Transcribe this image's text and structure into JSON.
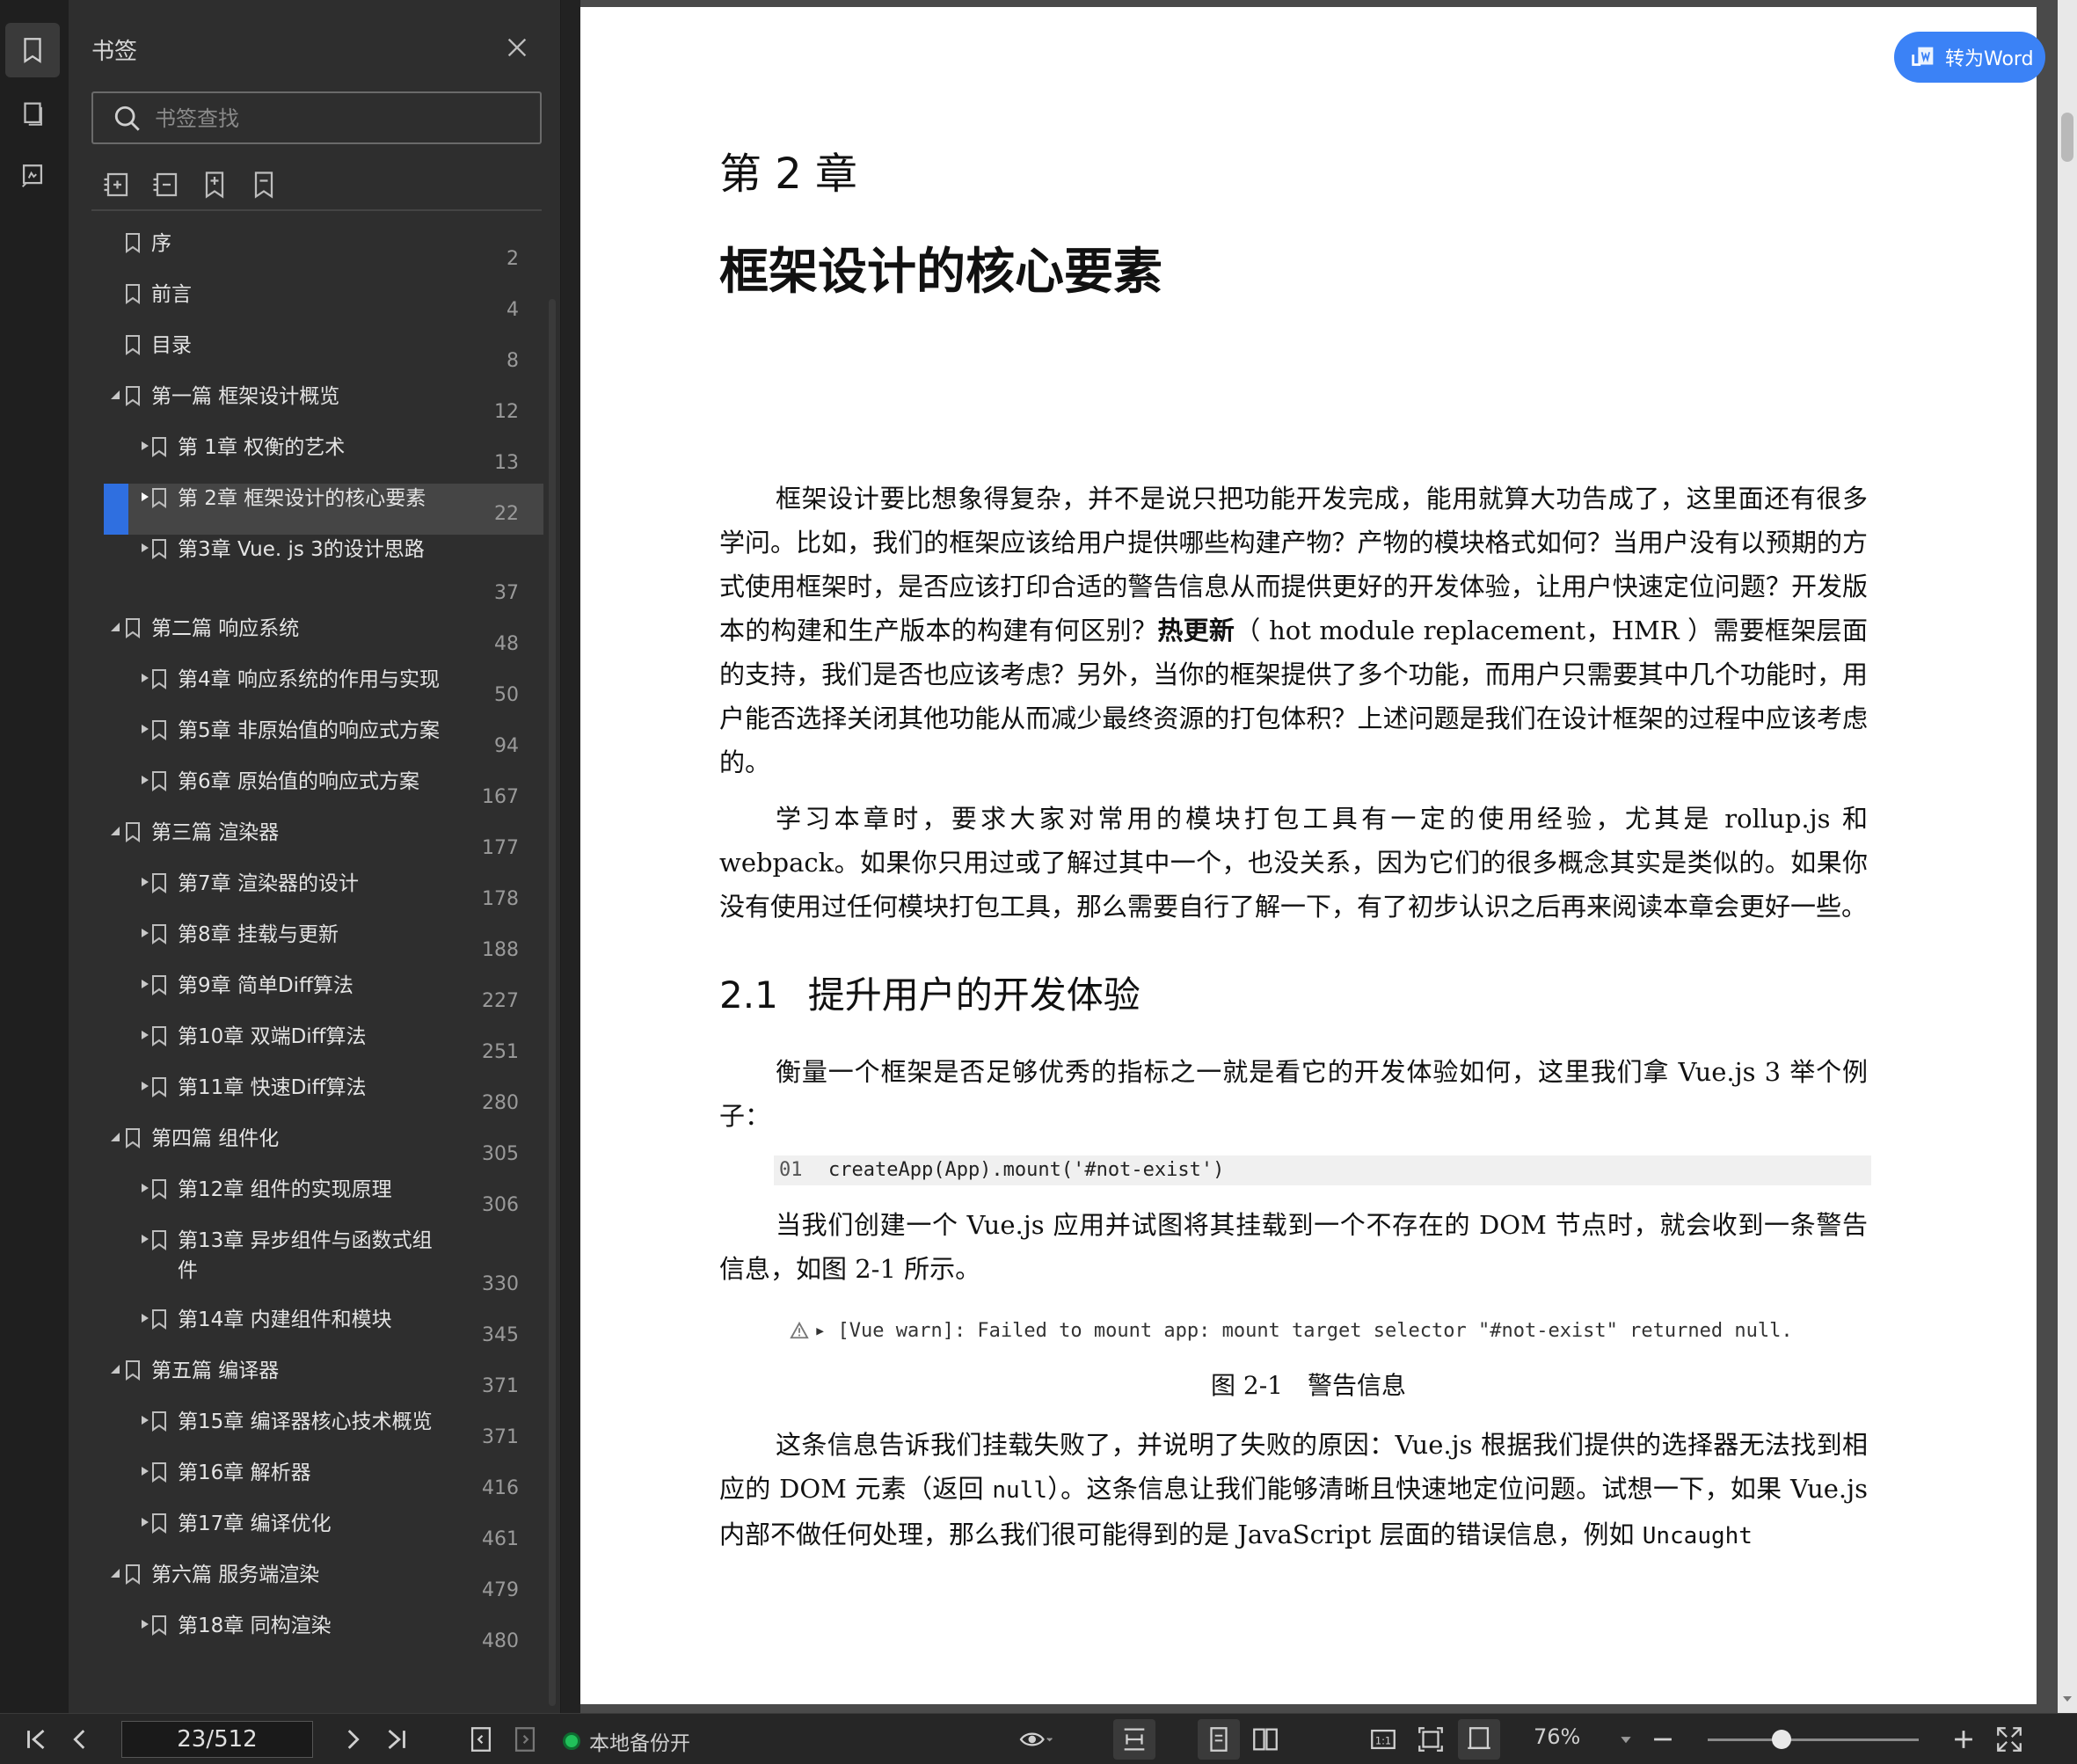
{
  "sidebar_panel": {
    "title": "书签",
    "search_placeholder": "书签查找",
    "items": [
      {
        "label": "序",
        "page": "2",
        "level": 0,
        "has_arrow": false
      },
      {
        "label": "前言",
        "page": "4",
        "level": 0,
        "has_arrow": false
      },
      {
        "label": "目录",
        "page": "8",
        "level": 0,
        "has_arrow": false
      },
      {
        "label": "第一篇 框架设计概览",
        "page": "12",
        "level": 0,
        "has_arrow": true,
        "expanded": true
      },
      {
        "label": "第 1章 权衡的艺术",
        "page": "13",
        "level": 1,
        "has_arrow": true
      },
      {
        "label": "第 2章 框架设计的核心要素",
        "page": "22",
        "level": 1,
        "has_arrow": true,
        "selected": true
      },
      {
        "label": "第3章 Vue. js 3的设计思路",
        "page": "37",
        "level": 1,
        "has_arrow": true
      },
      {
        "label": "第二篇 响应系统",
        "page": "48",
        "level": 0,
        "has_arrow": true,
        "expanded": true
      },
      {
        "label": "第4章 响应系统的作用与实现",
        "page": "50",
        "level": 1,
        "has_arrow": true
      },
      {
        "label": "第5章 非原始值的响应式方案",
        "page": "94",
        "level": 1,
        "has_arrow": true
      },
      {
        "label": "第6章 原始值的响应式方案",
        "page": "167",
        "level": 1,
        "has_arrow": true
      },
      {
        "label": "第三篇 渲染器",
        "page": "177",
        "level": 0,
        "has_arrow": true,
        "expanded": true
      },
      {
        "label": "第7章 渲染器的设计",
        "page": "178",
        "level": 1,
        "has_arrow": true
      },
      {
        "label": "第8章 挂载与更新",
        "page": "188",
        "level": 1,
        "has_arrow": true
      },
      {
        "label": "第9章 简单Diff算法",
        "page": "227",
        "level": 1,
        "has_arrow": true
      },
      {
        "label": "第10章 双端Diff算法",
        "page": "251",
        "level": 1,
        "has_arrow": true
      },
      {
        "label": "第11章 快速Diff算法",
        "page": "280",
        "level": 1,
        "has_arrow": true
      },
      {
        "label": "第四篇 组件化",
        "page": "305",
        "level": 0,
        "has_arrow": true,
        "expanded": true
      },
      {
        "label": "第12章 组件的实现原理",
        "page": "306",
        "level": 1,
        "has_arrow": true
      },
      {
        "label": "第13章 异步组件与函数式组件",
        "page": "330",
        "level": 1,
        "has_arrow": true
      },
      {
        "label": "第14章 内建组件和模块",
        "page": "345",
        "level": 1,
        "has_arrow": true
      },
      {
        "label": "第五篇 编译器",
        "page": "371",
        "level": 0,
        "has_arrow": true,
        "expanded": true
      },
      {
        "label": "第15章 编译器核心技术概览",
        "page": "371",
        "level": 1,
        "has_arrow": true
      },
      {
        "label": "第16章 解析器",
        "page": "416",
        "level": 1,
        "has_arrow": true
      },
      {
        "label": "第17章 编译优化",
        "page": "461",
        "level": 1,
        "has_arrow": true
      },
      {
        "label": "第六篇 服务端渲染",
        "page": "479",
        "level": 0,
        "has_arrow": true,
        "expanded": true
      },
      {
        "label": "第18章 同构渲染",
        "page": "480",
        "level": 1,
        "has_arrow": true
      }
    ]
  },
  "document": {
    "to_word_label": "转为Word",
    "chapter_number": "第 2 章",
    "chapter_title": "框架设计的核心要素",
    "para1_a": "框架设计要比想象得复杂，并不是说只把功能开发完成，能用就算大功告成了，这里面还有很多学问。比如，我们的框架应该给用户提供哪些构建产物？产物的模块格式如何？当用户没有以预期的方式使用框架时，是否应该打印合适的警告信息从而提供更好的开发体验，让用户快速定位问题？开发版本的构建和生产版本的构建有何区别？",
    "para1_bold": "热更新",
    "para1_b": "（ hot module replacement，HMR ）需要框架层面的支持，我们是否也应该考虑？另外，当你的框架提供了多个功能，而用户只需要其中几个功能时，用户能否选择关闭其他功能从而减少最终资源的打包体积？上述问题是我们在设计框架的过程中应该考虑的。",
    "para2": "学习本章时，要求大家对常用的模块打包工具有一定的使用经验，尤其是 rollup.js 和 webpack。如果你只用过或了解过其中一个，也没关系，因为它们的很多概念其实是类似的。如果你没有使用过任何模块打包工具，那么需要自行了解一下，有了初步认识之后再来阅读本章会更好一些。",
    "section_number": "2.1",
    "section_title": "提升用户的开发体验",
    "para3": "衡量一个框架是否足够优秀的指标之一就是看它的开发体验如何，这里我们拿 Vue.js 3 举个例子：",
    "code_line_no": "01",
    "code_line": "createApp(App).mount('#not-exist')",
    "para4": "当我们创建一个 Vue.js 应用并试图将其挂载到一个不存在的 DOM 节点时，就会收到一条警告信息，如图 2-1 所示。",
    "warn_text": "▸ [Vue warn]: Failed to mount app: mount target selector \"#not-exist\" returned null.",
    "figure_caption": "图 2-1　警告信息",
    "para5_a": "这条信息告诉我们挂载失败了，并说明了失败的原因：Vue.js 根据我们提供的选择器无法找到相应的 DOM 元素（返回 ",
    "para5_code": "null",
    "para5_b": "）。这条信息让我们能够清晰且快速地定位问题。试想一下，如果 Vue.js 内部不做任何处理，那么我们很可能得到的是 JavaScript 层面的错误信息，例如 ",
    "para5_code2": "Uncaught"
  },
  "status_bar": {
    "page_value": "23/512",
    "backup_label": "本地备份开",
    "zoom_label": "76%",
    "zoom_fraction": 0.35
  },
  "colors": {
    "accent": "#2f6fe0",
    "to_word": "#3b82f6",
    "backup_dot": "#21c05a"
  }
}
